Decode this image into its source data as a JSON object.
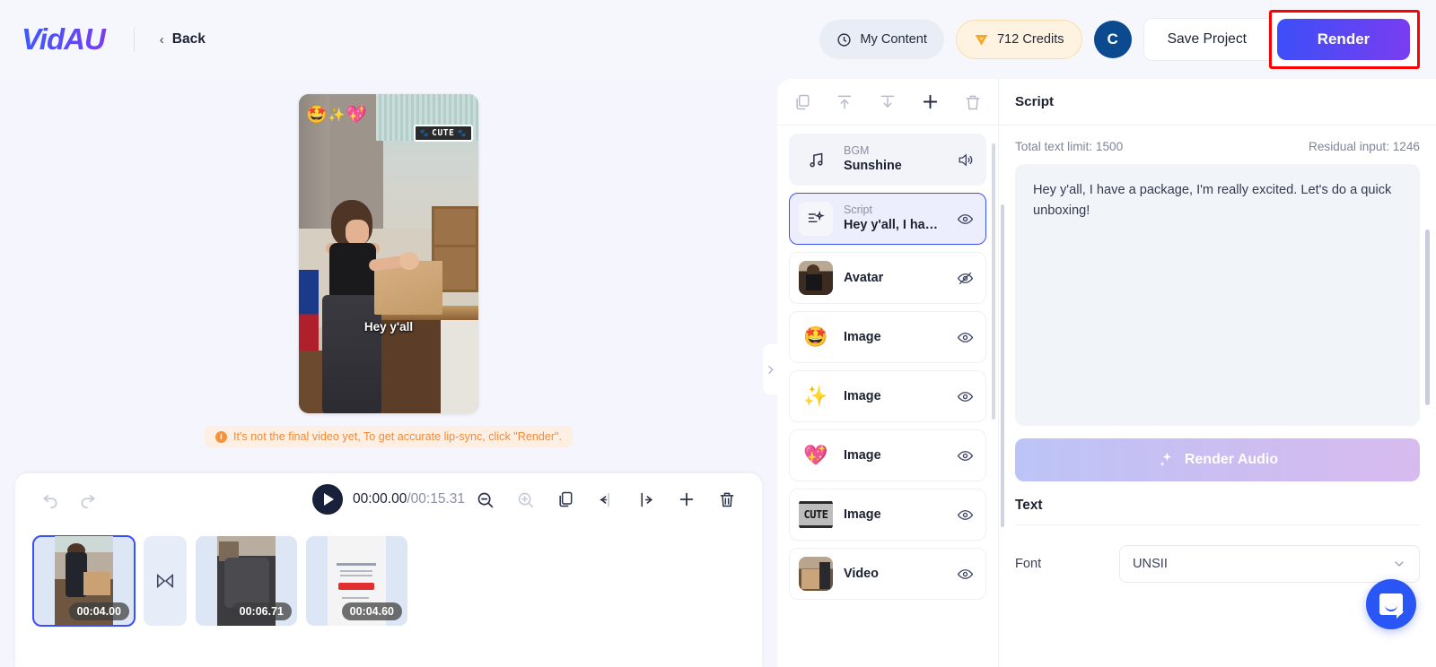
{
  "header": {
    "logo": "VidAU",
    "back_label": "Back",
    "my_content_label": "My Content",
    "credits_label": "712 Credits",
    "avatar_initial": "C",
    "save_project_label": "Save Project",
    "render_label": "Render",
    "highlight_color": "#ff0000",
    "render_gradient_start": "#3b4ff8",
    "render_gradient_end": "#7a3df0"
  },
  "preview": {
    "subtitle_text": "Hey y'all",
    "cute_badge": "CUTE",
    "paw_left": "🐾",
    "paw_right": "🐾",
    "stickers": [
      "🤩",
      "✨",
      "💖"
    ],
    "warning_text": "It's not the final video yet, To get accurate lip-sync, click \"Render\".",
    "warning_icon": "i",
    "warning_color": "#f08b3a"
  },
  "player": {
    "undo_icon": "undo-icon",
    "redo_icon": "redo-icon",
    "play_icon": "play-icon",
    "current_time": "00:00.00",
    "separator": " / ",
    "total_time": "00:15.31",
    "tools": [
      "zoom-out-icon",
      "zoom-in-icon",
      "duplicate-icon",
      "split-left-icon",
      "split-right-icon",
      "add-icon",
      "delete-icon"
    ]
  },
  "timeline": {
    "clips": [
      {
        "duration": "00:04.00",
        "selected": true,
        "name": "clip-thumbnail-1"
      },
      {
        "duration": "00:06.71",
        "selected": false,
        "name": "clip-thumbnail-2"
      },
      {
        "duration": "00:04.60",
        "selected": false,
        "name": "clip-thumbnail-3"
      }
    ],
    "transition_icon": "transition-icon"
  },
  "layers": {
    "toolbar": [
      "copy-icon",
      "move-up-icon",
      "move-down-icon",
      "add-icon",
      "delete-icon"
    ],
    "collapse_icon": "chevron-right-icon",
    "items": [
      {
        "sub": "BGM",
        "title": "Sunshine",
        "icon": "music-note-icon",
        "eye": "volume-icon",
        "state": "bgm"
      },
      {
        "sub": "Script",
        "title": "Hey y'all, I ha…",
        "icon": "script-sparkle-icon",
        "eye": "eye-icon",
        "state": "selected"
      },
      {
        "sub": "",
        "title": "Avatar",
        "icon": "avatar-thumbnail",
        "eye": "eye-off-icon",
        "state": "normal"
      },
      {
        "sub": "",
        "title": "Image",
        "icon": "🤩",
        "eye": "eye-icon",
        "state": "normal"
      },
      {
        "sub": "",
        "title": "Image",
        "icon": "✨",
        "eye": "eye-icon",
        "state": "normal"
      },
      {
        "sub": "",
        "title": "Image",
        "icon": "💖",
        "eye": "eye-icon",
        "state": "normal"
      },
      {
        "sub": "",
        "title": "Image",
        "icon": "CUTE",
        "eye": "eye-icon",
        "state": "normal"
      },
      {
        "sub": "",
        "title": "Video",
        "icon": "video-thumbnail",
        "eye": "eye-icon",
        "state": "normal"
      }
    ]
  },
  "script_panel": {
    "header": "Script",
    "total_limit": "Total text limit: 1500",
    "residual": "Residual input: 1246",
    "script_text": "Hey y'all, I have a package, I'm really excited. Let's do a quick unboxing!",
    "render_audio_label": "Render Audio",
    "render_audio_icon": "sparkle-icon",
    "text_section_title": "Text",
    "font_label": "Font",
    "font_value": "UNSII",
    "font_chevron": "chevron-down-icon"
  },
  "chat_widget": {
    "icon": "chat-bubble-icon",
    "color": "#2a56f5"
  }
}
